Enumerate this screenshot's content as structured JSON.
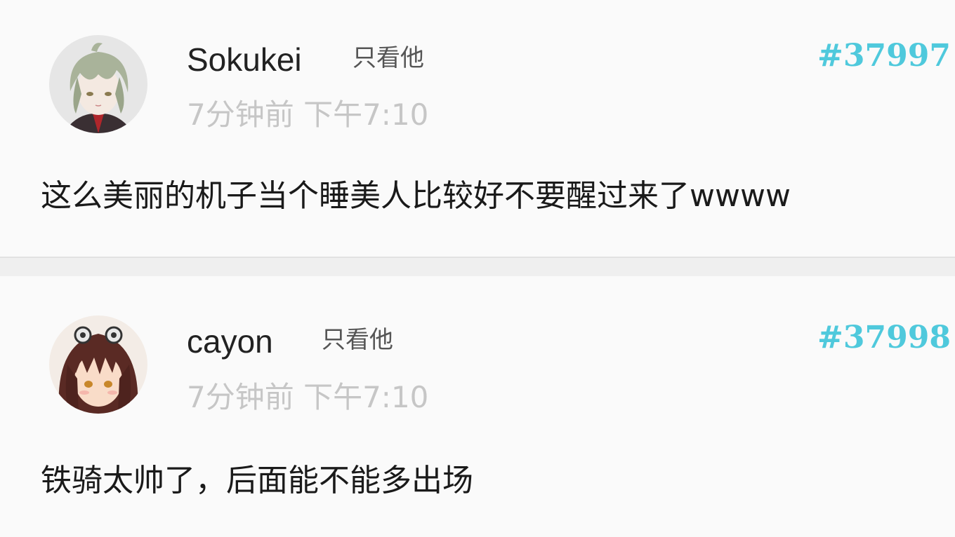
{
  "posts": [
    {
      "username": "Sokukei",
      "only_him_label": "只看他",
      "floor": "#37997",
      "time": "7分钟前 下午7:10",
      "content": "这么美丽的机子当个睡美人比较好不要醒过来了wwww",
      "avatar_icon": "avatar-silver-hair-character"
    },
    {
      "username": "cayon",
      "only_him_label": "只看他",
      "floor": "#37998",
      "time": "7分钟前 下午7:10",
      "content": "铁骑太帅了，后面能不能多出场",
      "avatar_icon": "avatar-brown-hair-character"
    }
  ],
  "colors": {
    "floor_accent": "#4fc9dc",
    "time_gray": "#c6c6c6",
    "background": "#fafafa"
  }
}
